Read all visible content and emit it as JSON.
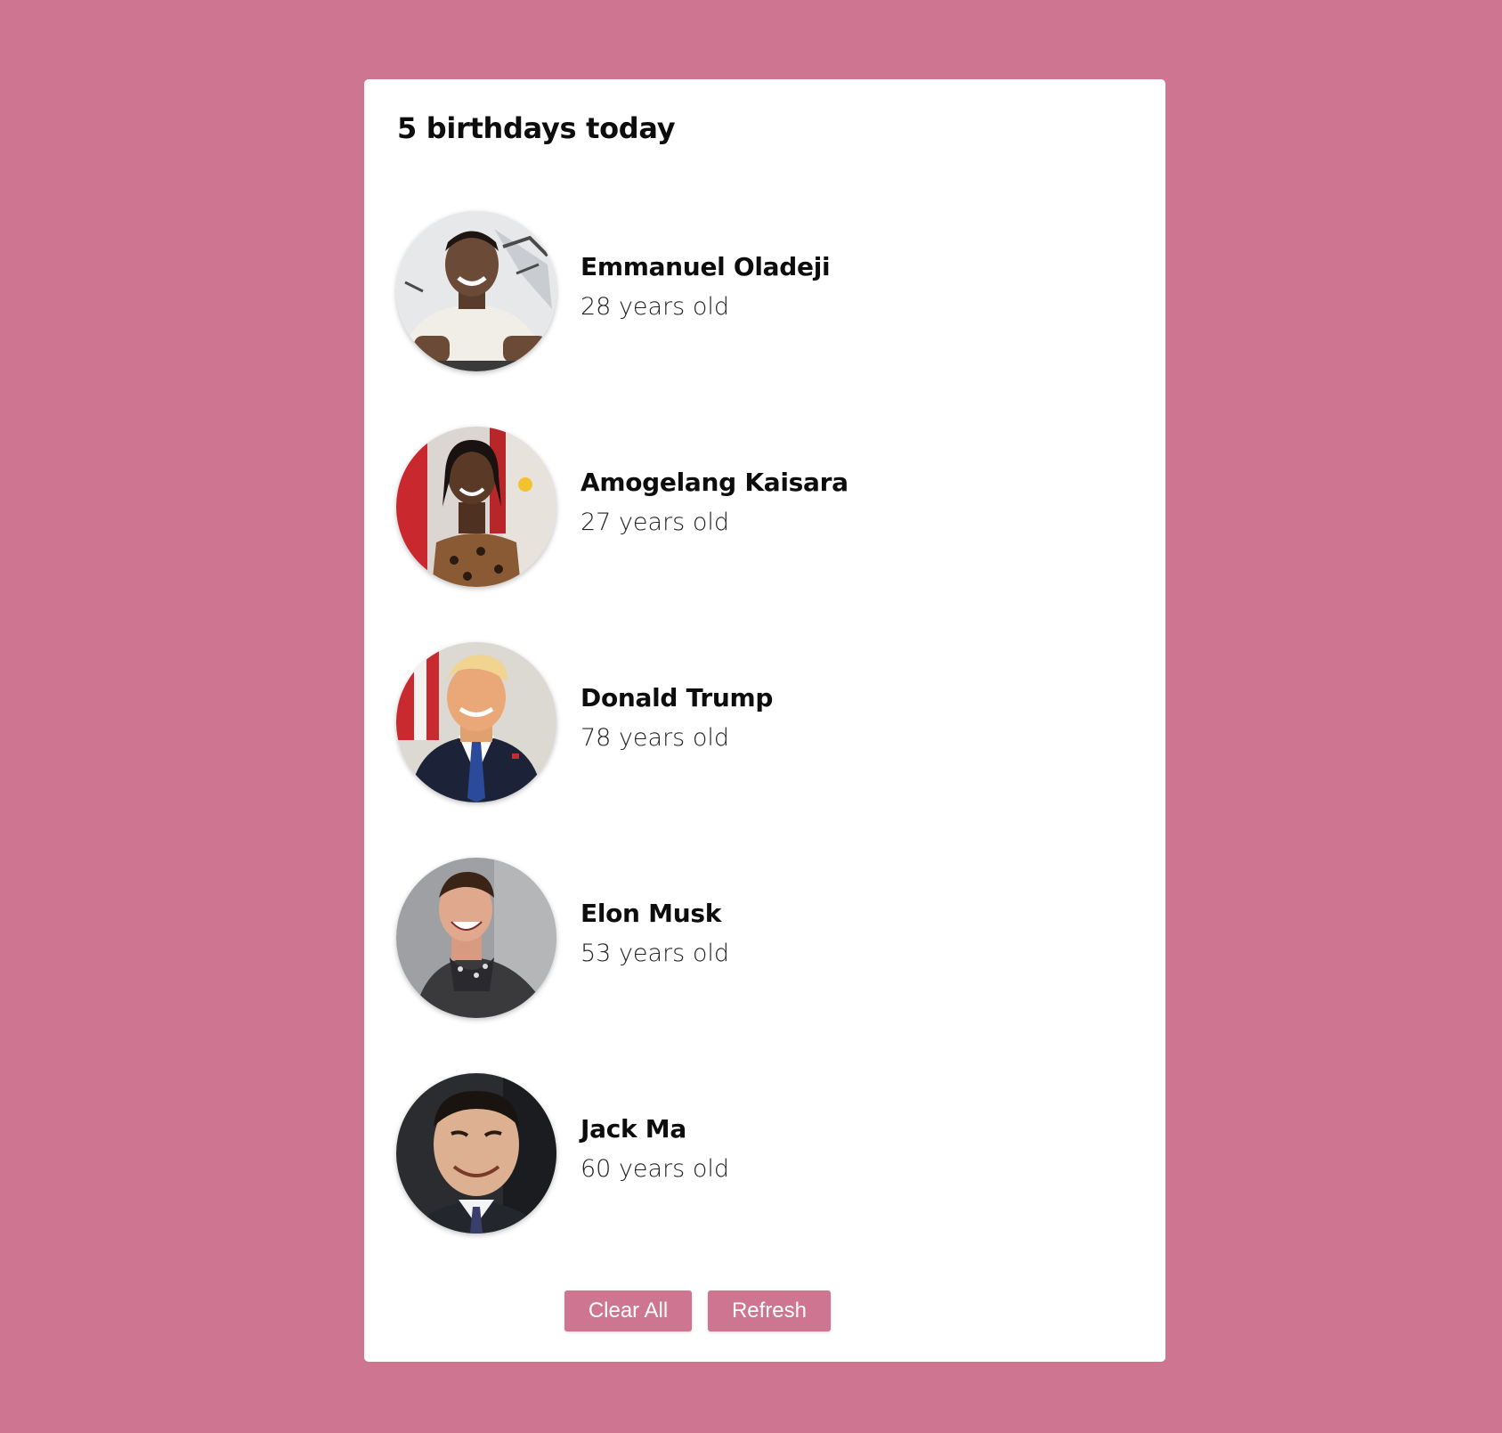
{
  "header": {
    "title": "5 birthdays today"
  },
  "people": [
    {
      "name": "Emmanuel Oladeji",
      "age": "28 years old"
    },
    {
      "name": "Amogelang Kaisara",
      "age": "27 years old"
    },
    {
      "name": "Donald Trump",
      "age": "78 years old"
    },
    {
      "name": "Elon Musk",
      "age": "53 years old"
    },
    {
      "name": "Jack Ma",
      "age": "60 years old"
    }
  ],
  "actions": {
    "clear_label": "Clear All",
    "refresh_label": "Refresh"
  },
  "colors": {
    "background": "#cd7591",
    "card": "#ffffff",
    "button": "#cd7591",
    "button_text": "#ffffff"
  }
}
